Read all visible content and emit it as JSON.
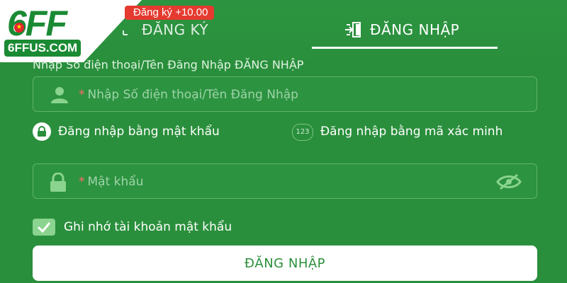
{
  "brand": {
    "logo_text": "6FF",
    "domain_text": "6FFUS.COM",
    "primary_color": "#2a8f3c",
    "promo_color": "#e53a30"
  },
  "promo": {
    "label": "Đăng ký +10.00"
  },
  "tabs": {
    "register": {
      "label": "ĐĂNG KÝ",
      "icon": "user-add-icon"
    },
    "login": {
      "label": "ĐĂNG NHẬP",
      "icon": "login-door-icon",
      "active": true
    }
  },
  "form": {
    "section_label": "Nhập Số điện thoại/Tên Đăng Nhập ĐĂNG NHẬP",
    "username": {
      "required_mark": "*",
      "placeholder": "Nhập Số điện thoại/Tên Đăng Nhập",
      "icon": "user-icon"
    },
    "options": {
      "password_login": {
        "label": "Đăng nhập bằng mật khẩu",
        "icon": "lock-icon",
        "selected": true
      },
      "code_login": {
        "label": "Đăng nhập bằng mã xác minh",
        "badge": "123"
      }
    },
    "password": {
      "required_mark": "*",
      "placeholder": "Mật khẩu",
      "icon": "lock-icon",
      "toggle_icon": "eye-off-icon"
    },
    "remember": {
      "label": "Ghi nhớ tài khoản mật khẩu",
      "checked": true
    },
    "submit_label": "ĐĂNG NHẬP"
  }
}
